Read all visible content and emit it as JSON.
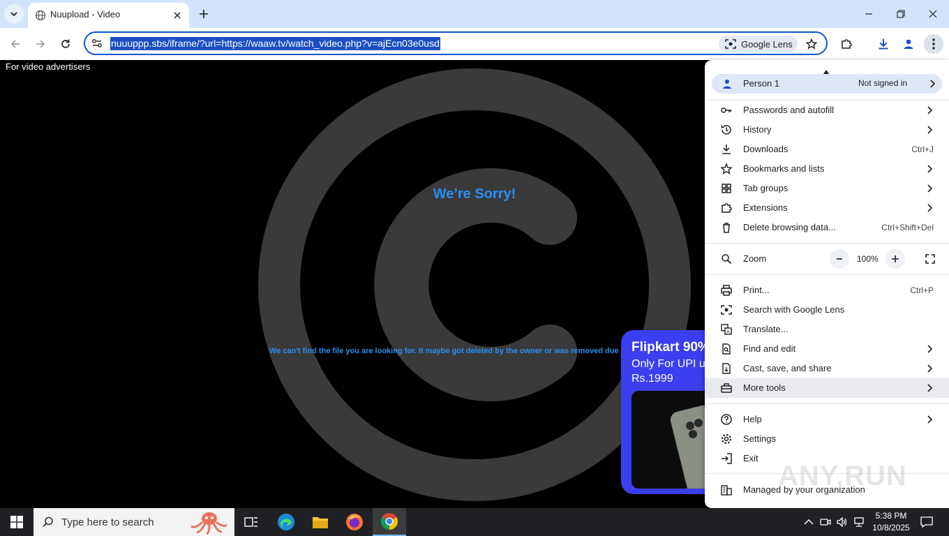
{
  "browser": {
    "tab_title": "Nuupload - Video",
    "url": "nuuuppp.sbs/iframe/?url=https://waaw.tv/watch_video.php?v=ajEcn03e0usd",
    "lens_label": "Google Lens"
  },
  "page": {
    "advertiser_label": "For video advertisers",
    "sorry_title": "We’re Sorry!",
    "sorry_message": "We can't find the file you are looking for. It maybe got deleted by the owner or was removed due a co",
    "ad": {
      "title": "Flipkart 90%",
      "line1": "Only For UPI u",
      "line2": "Rs.1999"
    }
  },
  "menu": {
    "profile_name": "Person 1",
    "profile_status": "Not signed in",
    "items": [
      {
        "label": "Passwords and autofill",
        "icon": "key-icon"
      },
      {
        "label": "History",
        "icon": "history-icon"
      },
      {
        "label": "Downloads",
        "icon": "download-icon",
        "shortcut": "Ctrl+J"
      },
      {
        "label": "Bookmarks and lists",
        "icon": "star-icon"
      },
      {
        "label": "Tab groups",
        "icon": "grid-icon"
      },
      {
        "label": "Extensions",
        "icon": "puzzle-icon"
      },
      {
        "label": "Delete browsing data...",
        "icon": "trash-icon",
        "shortcut": "Ctrl+Shift+Del"
      }
    ],
    "zoom_label": "Zoom",
    "zoom_value": "100%",
    "items2": [
      {
        "label": "Print...",
        "icon": "print-icon",
        "shortcut": "Ctrl+P"
      },
      {
        "label": "Search with Google Lens",
        "icon": "lens-icon"
      },
      {
        "label": "Translate...",
        "icon": "translate-icon"
      },
      {
        "label": "Find and edit",
        "icon": "find-icon"
      },
      {
        "label": "Cast, save, and share",
        "icon": "cast-icon"
      },
      {
        "label": "More tools",
        "icon": "toolbox-icon"
      }
    ],
    "items3": [
      {
        "label": "Help",
        "icon": "help-icon"
      },
      {
        "label": "Settings",
        "icon": "settings-icon"
      },
      {
        "label": "Exit",
        "icon": "exit-icon"
      }
    ],
    "managed": "Managed by your organization"
  },
  "taskbar": {
    "search_placeholder": "Type here to search",
    "time": "5:38 PM",
    "date": "10/8/2025"
  },
  "watermark": "ANY.RUN",
  "colors": {
    "accent": "#0b57d0",
    "page_text": "#2a8ff0",
    "ad_bg": "#3a3fef",
    "tabstrip": "#d3e3fd"
  }
}
